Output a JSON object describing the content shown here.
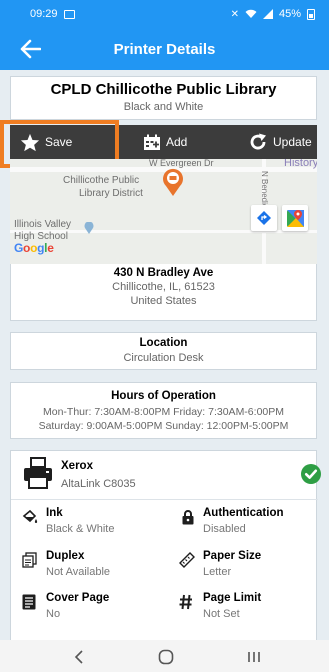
{
  "status_bar": {
    "time": "09:29",
    "battery": "45%"
  },
  "header": {
    "title": "Printer Details"
  },
  "printer": {
    "name": "CPLD Chillicothe Public Library",
    "color_mode": "Black and White"
  },
  "toolbar": {
    "save_label": "Save",
    "add_label": "Add",
    "update_label": "Update"
  },
  "map": {
    "street": "W Evergreen Dr",
    "poi_line1": "Chillicothe Public",
    "poi_line2": "Library District",
    "school_line1": "Illinois Valley",
    "school_line2": "High School",
    "history_label": "History",
    "side_street": "N Benedict"
  },
  "address": {
    "street": "430 N Bradley Ave",
    "city_line": "Chillicothe, IL, 61523",
    "country": "United States"
  },
  "location": {
    "heading": "Location",
    "value": "Circulation Desk"
  },
  "hours": {
    "heading": "Hours of Operation",
    "line1": "Mon-Thur: 7:30AM-8:00PM Friday: 7:30AM-6:00PM",
    "line2": "Saturday: 9:00AM-5:00PM Sunday: 12:00PM-5:00PM"
  },
  "device": {
    "make": "Xerox",
    "model": "AltaLink C8035",
    "features": {
      "ink": {
        "label": "Ink",
        "value": "Black & White"
      },
      "authentication": {
        "label": "Authentication",
        "value": "Disabled"
      },
      "duplex": {
        "label": "Duplex",
        "value": "Not Available"
      },
      "paper_size": {
        "label": "Paper Size",
        "value": "Letter"
      },
      "cover_page": {
        "label": "Cover Page",
        "value": "No"
      },
      "page_limit": {
        "label": "Page Limit",
        "value": "Not Set"
      }
    }
  },
  "colors": {
    "primary": "#2196f3",
    "highlight": "#ef7d22",
    "check": "#2e9e44",
    "toolbar": "#3c3c3c",
    "map_pin": "#e8742c"
  },
  "icons": {
    "back": "arrow-left-icon",
    "save": "star-icon",
    "add": "calendar-add-icon",
    "update": "refresh-icon",
    "printer": "printer-icon",
    "status": "check-circle-icon",
    "ink": "ink-drop-icon",
    "authentication": "lock-icon",
    "duplex": "duplex-icon",
    "paper_size": "ruler-icon",
    "cover_page": "document-icon",
    "page_limit": "hash-icon"
  }
}
